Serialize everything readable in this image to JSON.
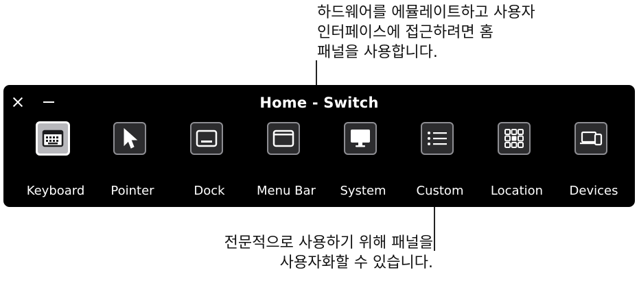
{
  "callouts": {
    "top": [
      "하드웨어를 에뮬레이트하고 사용자",
      "인터페이스에 접근하려면 홈",
      "패널을 사용합니다."
    ],
    "bottom": [
      "전문적으로 사용하기 위해 패널을",
      "사용자화할 수 있습니다."
    ]
  },
  "panel": {
    "title": "Home - Switch",
    "items": [
      {
        "label": "Keyboard",
        "icon": "keyboard-icon",
        "selected": true
      },
      {
        "label": "Pointer",
        "icon": "pointer-icon",
        "selected": false
      },
      {
        "label": "Dock",
        "icon": "dock-icon",
        "selected": false
      },
      {
        "label": "Menu Bar",
        "icon": "menu-bar-icon",
        "selected": false
      },
      {
        "label": "System",
        "icon": "system-icon",
        "selected": false
      },
      {
        "label": "Custom",
        "icon": "custom-list-icon",
        "selected": false
      },
      {
        "label": "Location",
        "icon": "location-grid-icon",
        "selected": false
      },
      {
        "label": "Devices",
        "icon": "devices-icon",
        "selected": false
      }
    ]
  },
  "colors": {
    "panel_bg": "#000000",
    "tile_bg": "#2c2c2e",
    "tile_border": "#8e8e93",
    "selected_tile_bg": "#b8b8bc"
  }
}
